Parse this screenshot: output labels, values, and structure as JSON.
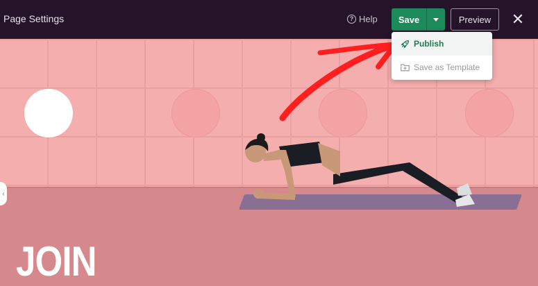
{
  "topbar": {
    "title": "Page Settings",
    "help_label": "Help",
    "save_label": "Save",
    "preview_label": "Preview",
    "close_glyph": "✕"
  },
  "dropdown": {
    "items": [
      {
        "label": "Publish",
        "icon": "rocket-icon"
      },
      {
        "label": "Save as Template",
        "icon": "template-icon"
      }
    ]
  },
  "canvas": {
    "headline": "JOIN"
  },
  "colors": {
    "topbar_bg": "#241329",
    "save_green": "#1c8a5a",
    "publish_text": "#1d7a52",
    "pink_wall": "#f5aeae",
    "pink_floor": "#d5898c",
    "annotation_arrow": "#ff1f1f"
  }
}
